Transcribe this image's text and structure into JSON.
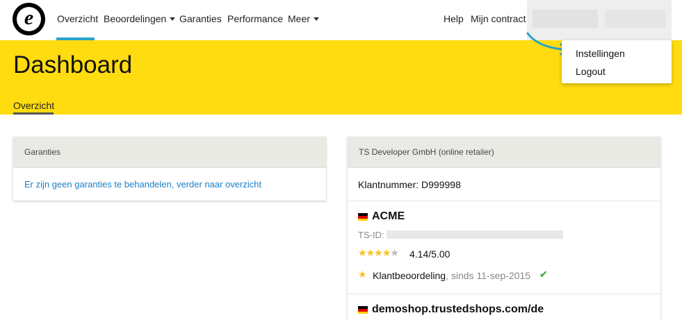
{
  "nav": {
    "logo_letter": "e",
    "items": [
      {
        "label": "Overzicht",
        "active": true
      },
      {
        "label": "Beoordelingen",
        "dropdown": true
      },
      {
        "label": "Garanties"
      },
      {
        "label": "Performance"
      },
      {
        "label": "Meer",
        "dropdown": true
      }
    ],
    "right": {
      "help": "Help",
      "contract": "Mijn contract"
    },
    "accent_color": "#2aa3c9"
  },
  "header": {
    "title": "Dashboard",
    "tab": "Overzicht",
    "background": "#ffdc0f"
  },
  "dropdown_menu": {
    "items": [
      "Instellingen",
      "Logout"
    ]
  },
  "left_card": {
    "title": "Garanties",
    "link_text": "Er zijn geen garanties te behandelen, verder naar overzicht"
  },
  "right_card": {
    "title": "TS Developer GmbH (online retailer)",
    "customer_number": "Klantnummer: D999998",
    "shops": [
      {
        "flag": "de",
        "name": "ACME",
        "tsid_label": "TS-ID:",
        "rating": "4.14/5.00",
        "stars_filled": 4,
        "stars_total": 5,
        "review_label": "Klantbeoordeling",
        "review_since": ", sinds 11-sep-2015",
        "verified": true
      },
      {
        "flag": "de",
        "name": "demoshop.trustedshops.com/de"
      }
    ]
  }
}
